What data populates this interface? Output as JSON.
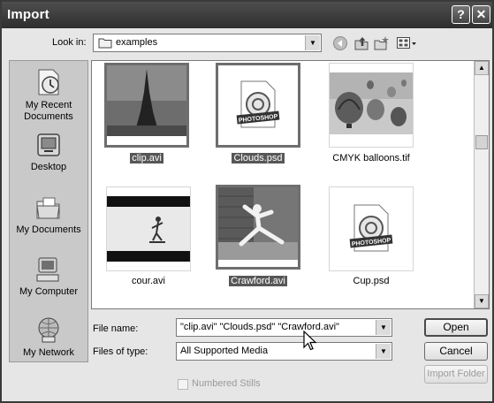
{
  "dialog": {
    "title": "Import",
    "help_glyph": "?",
    "close_glyph": "✕"
  },
  "lookin": {
    "label": "Look in:",
    "value": "examples"
  },
  "places": [
    {
      "label_line1": "My Recent",
      "label_line2": "Documents",
      "icon": "recent-documents-icon"
    },
    {
      "label_line1": "Desktop",
      "label_line2": "",
      "icon": "desktop-icon"
    },
    {
      "label_line1": "My Documents",
      "label_line2": "",
      "icon": "my-documents-icon"
    },
    {
      "label_line1": "My Computer",
      "label_line2": "",
      "icon": "my-computer-icon"
    },
    {
      "label_line1": "My Network",
      "label_line2": "",
      "icon": "my-network-icon"
    }
  ],
  "files": [
    {
      "name": "clip.avi",
      "selected": true,
      "preview": "eiffel-tower-photo"
    },
    {
      "name": "Clouds.psd",
      "selected": true,
      "preview": "photoshop-document-icon"
    },
    {
      "name": "CMYK balloons.tif",
      "selected": false,
      "preview": "hot-air-balloons-photo"
    },
    {
      "name": "cour.avi",
      "selected": false,
      "preview": "skateboarder-photo"
    },
    {
      "name": "Crawford.avi",
      "selected": true,
      "preview": "dancer-photo"
    },
    {
      "name": "Cup.psd",
      "selected": false,
      "preview": "photoshop-document-icon"
    }
  ],
  "photoshop_badge": "PHOTOSHOP",
  "filename": {
    "label": "File name:",
    "value": "\"clip.avi\" \"Clouds.psd\" \"Crawford.avi\""
  },
  "filetype": {
    "label": "Files of type:",
    "value": "All Supported Media"
  },
  "buttons": {
    "open": "Open",
    "cancel": "Cancel",
    "import_folder": "Import Folder"
  },
  "numbered_stills": {
    "label": "Numbered Stills",
    "checked": false,
    "enabled": false
  }
}
